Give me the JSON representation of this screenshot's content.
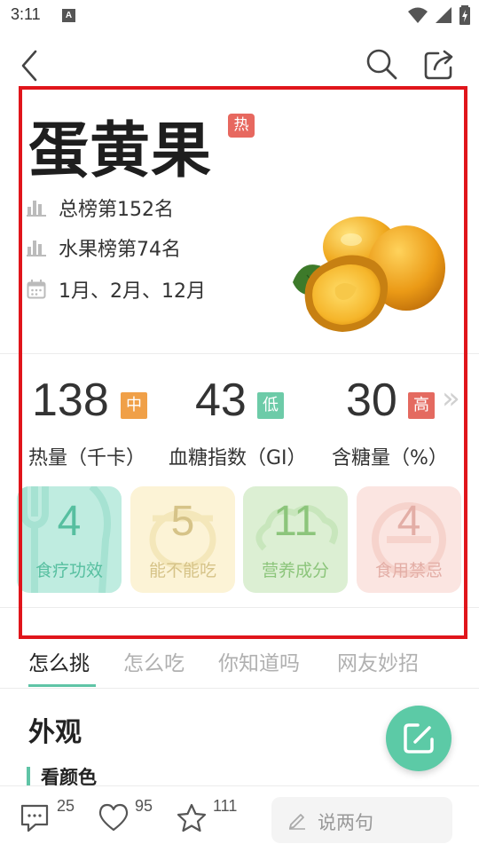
{
  "status_bar": {
    "time": "3:11",
    "notification_letter": "A"
  },
  "food": {
    "name": "蛋黄果",
    "hot_badge": "热"
  },
  "info": [
    {
      "icon": "bar-chart-icon",
      "text": "总榜第152名"
    },
    {
      "icon": "bar-chart-icon",
      "text": "水果榜第74名"
    },
    {
      "icon": "calendar-icon",
      "text": "1月、2月、12月"
    }
  ],
  "stats": [
    {
      "value": "138",
      "tag": "中",
      "tag_color": "#f0a048",
      "label": "热量（千卡）"
    },
    {
      "value": "43",
      "tag": "低",
      "tag_color": "#6dcba8",
      "label": "血糖指数（GI）"
    },
    {
      "value": "30",
      "tag": "高",
      "tag_color": "#e46a60",
      "label": "含糖量（%）"
    }
  ],
  "more_arrows": "»",
  "cards": [
    {
      "number": "4",
      "label": "食疗功效",
      "bg": "#bfece0",
      "fg": "#57bfa0"
    },
    {
      "number": "5",
      "label": "能不能吃",
      "bg": "#fcf3d6",
      "fg": "#d6c388"
    },
    {
      "number": "11",
      "label": "营养成分",
      "bg": "#dcefd3",
      "fg": "#8cc57b"
    },
    {
      "number": "4",
      "label": "食用禁忌",
      "bg": "#fbe5e1",
      "fg": "#e3aea6"
    }
  ],
  "tabs": [
    {
      "label": "怎么挑",
      "active": true
    },
    {
      "label": "怎么吃",
      "active": false
    },
    {
      "label": "你知道吗",
      "active": false
    },
    {
      "label": "网友妙招",
      "active": false
    }
  ],
  "content": {
    "section_title": "外观",
    "sub_title": "看颜色"
  },
  "bottom_bar": {
    "comments": "25",
    "likes": "95",
    "favorites": "111",
    "comment_placeholder": "说两句"
  },
  "colors": {
    "accent": "#5fc4a6",
    "highlight": "#e0151b",
    "hot": "#e7685f"
  }
}
